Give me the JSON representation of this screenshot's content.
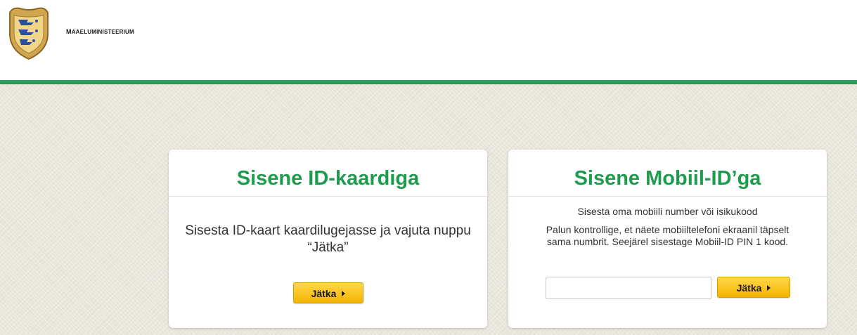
{
  "header": {
    "org_name": "Maaeluministeerium",
    "logo_icon": "estonia-coat-of-arms-icon"
  },
  "colors": {
    "accent_green": "#1f9b4d",
    "line_green": "#2e9e5b",
    "button_yellow": "#f4b400"
  },
  "id_card": {
    "title": "Sisene ID-kaardiga",
    "instructions": "Sisesta ID-kaart kaardilugejasse ja vajuta nuppu “Jätka”",
    "button_label": "Jätka",
    "button_icon": "triangle-right-icon"
  },
  "mobile_id": {
    "title": "Sisene Mobiil-ID’ga",
    "hint": "Sisesta oma mobiili number või isikukood",
    "instructions": "Palun kontrollige, et näete mobiiltelefoni ekraanil täpselt sama numbrit. Seejärel sisestage Mobiil-ID PIN 1 kood.",
    "input_value": "",
    "input_placeholder": "",
    "button_label": "Jätka",
    "button_icon": "triangle-right-icon"
  }
}
